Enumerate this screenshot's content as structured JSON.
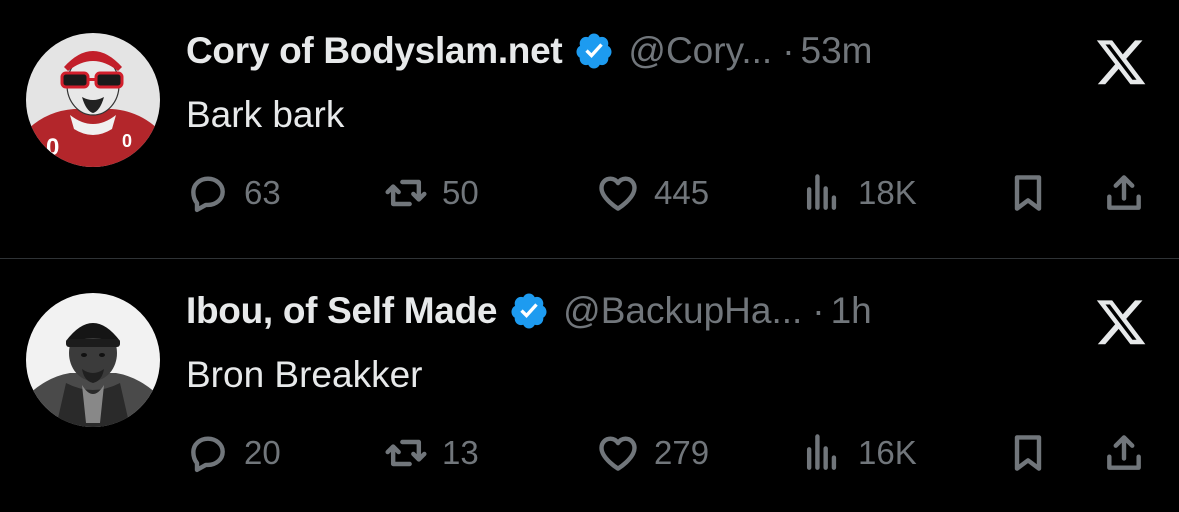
{
  "tweets": [
    {
      "name": "Cory of Bodyslam.net",
      "handle": "@Cory...",
      "separator": "·",
      "time": "53m",
      "text": "Bark bark",
      "replies": "63",
      "reposts": "50",
      "likes": "445",
      "views": "18K",
      "avatar_icon": "avatar-red-jersey-sunglasses",
      "verified_icon": "verified-badge-icon"
    },
    {
      "name": "Ibou, of Self Made",
      "handle": "@BackupHa...",
      "separator": "·",
      "time": "1h",
      "text": "Bron Breakker",
      "replies": "20",
      "reposts": "13",
      "likes": "279",
      "views": "16K",
      "avatar_icon": "avatar-grayscale-beanie",
      "verified_icon": "verified-badge-icon"
    }
  ],
  "colors": {
    "background": "#000000",
    "text_primary": "#e7e9ea",
    "text_secondary": "#71767b",
    "verified_blue": "#1d9bf0",
    "divider": "#2f3336"
  },
  "icons": {
    "reply": "reply-icon",
    "repost": "repost-icon",
    "like": "like-icon",
    "views": "views-icon",
    "bookmark": "bookmark-icon",
    "share": "share-icon",
    "platform_logo": "x-logo-icon"
  }
}
